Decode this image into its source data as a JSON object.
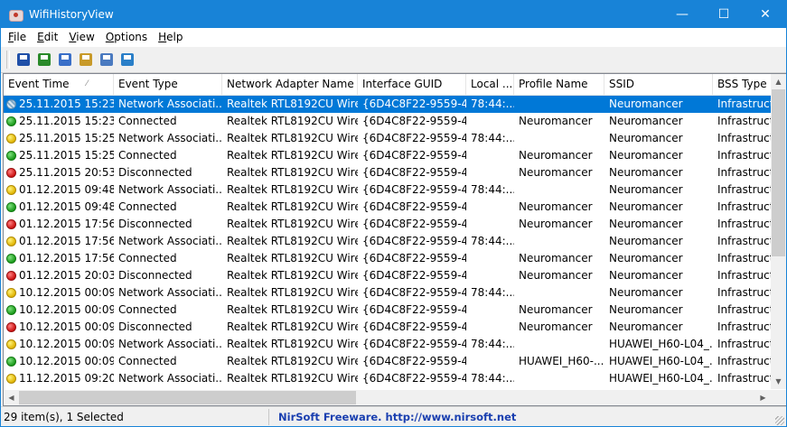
{
  "window": {
    "title": "WifiHistoryView",
    "controls": {
      "minimize": "—",
      "maximize": "☐",
      "close": "✕"
    }
  },
  "menu": [
    {
      "accel": "F",
      "rest": "ile"
    },
    {
      "accel": "E",
      "rest": "dit"
    },
    {
      "accel": "V",
      "rest": "iew"
    },
    {
      "accel": "O",
      "rest": "ptions"
    },
    {
      "accel": "H",
      "rest": "elp"
    }
  ],
  "toolbar": {
    "buttons": [
      {
        "name": "save-icon",
        "color": "#1f4fa8"
      },
      {
        "name": "refresh-icon",
        "color": "#2a8a2a"
      },
      {
        "name": "copy-icon",
        "color": "#3a6fc8"
      },
      {
        "name": "properties-icon",
        "color": "#c89a2a"
      },
      {
        "name": "find-icon",
        "color": "#4a7ac0"
      },
      {
        "name": "exit-icon",
        "color": "#2a7fc8"
      }
    ]
  },
  "table": {
    "columns": [
      "Event Time",
      "Event Type",
      "Network Adapter Name",
      "Interface GUID",
      "Local ...",
      "Profile Name",
      "SSID",
      "BSS Type"
    ],
    "rows": [
      {
        "status": "selected",
        "cells": [
          "25.11.2015 15:23:...",
          "Network Associati...",
          "Realtek RTL8192CU Wire...",
          "{6D4C8F22-9559-4...",
          "78:44:...",
          "",
          "Neuromancer",
          "Infrastructu"
        ]
      },
      {
        "status": "green",
        "cells": [
          "25.11.2015 15:23:...",
          "Connected",
          "Realtek RTL8192CU Wire...",
          "{6D4C8F22-9559-4...",
          "",
          "Neuromancer",
          "Neuromancer",
          "Infrastructu"
        ]
      },
      {
        "status": "yellow",
        "cells": [
          "25.11.2015 15:25:...",
          "Network Associati...",
          "Realtek RTL8192CU Wire...",
          "{6D4C8F22-9559-4...",
          "78:44:...",
          "",
          "Neuromancer",
          "Infrastructu"
        ]
      },
      {
        "status": "green",
        "cells": [
          "25.11.2015 15:25:...",
          "Connected",
          "Realtek RTL8192CU Wire...",
          "{6D4C8F22-9559-4...",
          "",
          "Neuromancer",
          "Neuromancer",
          "Infrastructu"
        ]
      },
      {
        "status": "red",
        "cells": [
          "25.11.2015 20:53:...",
          "Disconnected",
          "Realtek RTL8192CU Wire...",
          "{6D4C8F22-9559-4...",
          "",
          "Neuromancer",
          "Neuromancer",
          "Infrastructu"
        ]
      },
      {
        "status": "yellow",
        "cells": [
          "01.12.2015 09:48:...",
          "Network Associati...",
          "Realtek RTL8192CU Wire...",
          "{6D4C8F22-9559-4...",
          "78:44:...",
          "",
          "Neuromancer",
          "Infrastructu"
        ]
      },
      {
        "status": "green",
        "cells": [
          "01.12.2015 09:48:...",
          "Connected",
          "Realtek RTL8192CU Wire...",
          "{6D4C8F22-9559-4...",
          "",
          "Neuromancer",
          "Neuromancer",
          "Infrastructu"
        ]
      },
      {
        "status": "red",
        "cells": [
          "01.12.2015 17:56:...",
          "Disconnected",
          "Realtek RTL8192CU Wire...",
          "{6D4C8F22-9559-4...",
          "",
          "Neuromancer",
          "Neuromancer",
          "Infrastructu"
        ]
      },
      {
        "status": "yellow",
        "cells": [
          "01.12.2015 17:56:...",
          "Network Associati...",
          "Realtek RTL8192CU Wire...",
          "{6D4C8F22-9559-4...",
          "78:44:...",
          "",
          "Neuromancer",
          "Infrastructu"
        ]
      },
      {
        "status": "green",
        "cells": [
          "01.12.2015 17:56:...",
          "Connected",
          "Realtek RTL8192CU Wire...",
          "{6D4C8F22-9559-4...",
          "",
          "Neuromancer",
          "Neuromancer",
          "Infrastructu"
        ]
      },
      {
        "status": "red",
        "cells": [
          "01.12.2015 20:03:...",
          "Disconnected",
          "Realtek RTL8192CU Wire...",
          "{6D4C8F22-9559-4...",
          "",
          "Neuromancer",
          "Neuromancer",
          "Infrastructu"
        ]
      },
      {
        "status": "yellow",
        "cells": [
          "10.12.2015 00:09:...",
          "Network Associati...",
          "Realtek RTL8192CU Wire...",
          "{6D4C8F22-9559-4...",
          "78:44:...",
          "",
          "Neuromancer",
          "Infrastructu"
        ]
      },
      {
        "status": "green",
        "cells": [
          "10.12.2015 00:09:...",
          "Connected",
          "Realtek RTL8192CU Wire...",
          "{6D4C8F22-9559-4...",
          "",
          "Neuromancer",
          "Neuromancer",
          "Infrastructu"
        ]
      },
      {
        "status": "red",
        "cells": [
          "10.12.2015 00:09:...",
          "Disconnected",
          "Realtek RTL8192CU Wire...",
          "{6D4C8F22-9559-4...",
          "",
          "Neuromancer",
          "Neuromancer",
          "Infrastructu"
        ]
      },
      {
        "status": "yellow",
        "cells": [
          "10.12.2015 00:09:...",
          "Network Associati...",
          "Realtek RTL8192CU Wire...",
          "{6D4C8F22-9559-4...",
          "78:44:...",
          "",
          "HUAWEI_H60-L04_...",
          "Infrastructu"
        ]
      },
      {
        "status": "green",
        "cells": [
          "10.12.2015 00:09:...",
          "Connected",
          "Realtek RTL8192CU Wire...",
          "{6D4C8F22-9559-4...",
          "",
          "HUAWEI_H60-...",
          "HUAWEI_H60-L04_...",
          "Infrastructu"
        ]
      },
      {
        "status": "yellow",
        "cells": [
          "11.12.2015 09:20:...",
          "Network Associati...",
          "Realtek RTL8192CU Wire...",
          "{6D4C8F22-9559-4...",
          "78:44:...",
          "",
          "HUAWEI_H60-L04_...",
          "Infrastructu"
        ]
      }
    ]
  },
  "status": {
    "count": "29 item(s), 1 Selected",
    "link": "NirSoft Freeware.  http://www.nirsoft.net"
  }
}
